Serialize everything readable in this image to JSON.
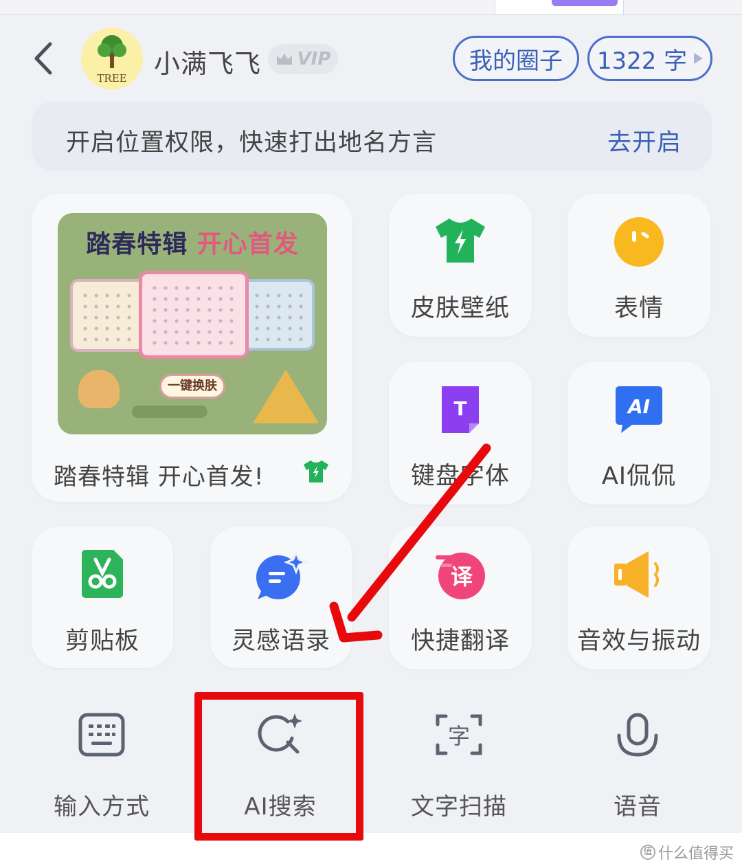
{
  "header": {
    "username": "小满飞飞",
    "vip_label": "VIP",
    "avatar_text": "TREE",
    "my_circle_label": "我的圈子",
    "word_count_label": "1322 字"
  },
  "location_banner": {
    "text": "开启位置权限，快速打出地名方言",
    "action_label": "去开启"
  },
  "promo_card": {
    "image_title_a": "踏春特辑",
    "image_title_b": "开心首发",
    "image_button": "一键换肤",
    "caption": "踏春特辑 开心首发!"
  },
  "tiles": [
    {
      "label": "皮肤壁纸",
      "icon": "shirt-icon"
    },
    {
      "label": "表情",
      "icon": "emoji-icon"
    },
    {
      "label": "键盘字体",
      "icon": "font-icon"
    },
    {
      "label": "AI侃侃",
      "icon": "ai-chat-icon",
      "icon_text": "AI"
    },
    {
      "label": "剪贴板",
      "icon": "scissors-icon"
    },
    {
      "label": "灵感语录",
      "icon": "inspiration-icon"
    },
    {
      "label": "快捷翻译",
      "icon": "translate-icon",
      "icon_text": "译"
    },
    {
      "label": "音效与振动",
      "icon": "speaker-icon"
    }
  ],
  "bottom_row": [
    {
      "label": "输入方式",
      "icon": "keyboard-icon"
    },
    {
      "label": "AI搜索",
      "icon": "ai-search-icon"
    },
    {
      "label": "文字扫描",
      "icon": "text-scan-icon",
      "icon_text": "字"
    },
    {
      "label": "语音",
      "icon": "microphone-icon"
    }
  ],
  "watermark": "什么值得买",
  "colors": {
    "accent_blue": "#3b5fb8",
    "skin_green": "#22b25a",
    "emoji_yellow": "#f8b820",
    "font_purple": "#8b3ff0",
    "ai_blue": "#2f6ff0",
    "clipboard_green": "#2db35a",
    "inspiration_blue": "#3a6ff2",
    "translate_pink": "#f0457a",
    "speaker_orange": "#f7b22a",
    "annotation_red": "#e8090d"
  }
}
